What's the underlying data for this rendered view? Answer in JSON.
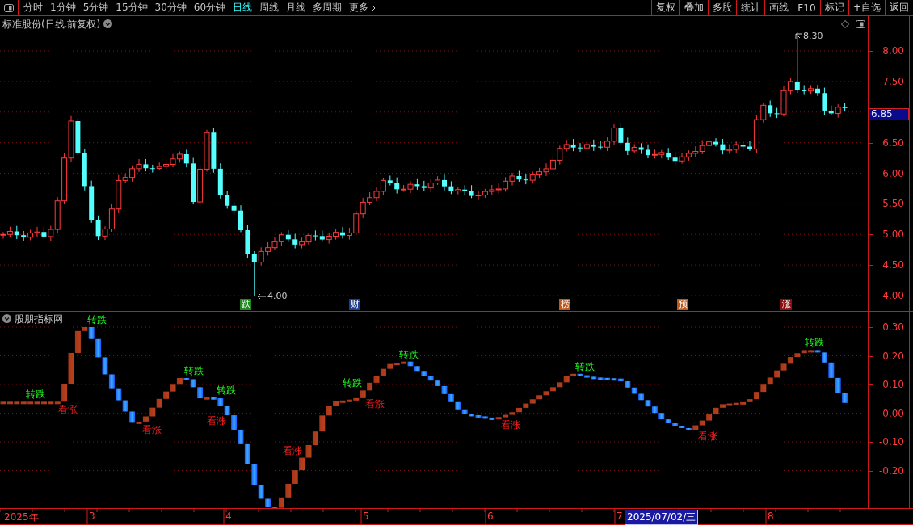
{
  "toolbar": {
    "periods": [
      {
        "label": "分时",
        "selected": false
      },
      {
        "label": "1分钟",
        "selected": false
      },
      {
        "label": "5分钟",
        "selected": false
      },
      {
        "label": "15分钟",
        "selected": false
      },
      {
        "label": "30分钟",
        "selected": false
      },
      {
        "label": "60分钟",
        "selected": false
      },
      {
        "label": "日线",
        "selected": true
      },
      {
        "label": "周线",
        "selected": false
      },
      {
        "label": "月线",
        "selected": false
      },
      {
        "label": "多周期",
        "selected": false
      }
    ],
    "more": "更多",
    "actions": [
      "复权",
      "叠加",
      "多股",
      "统计",
      "画线",
      "F10",
      "标记",
      "+自选",
      "返回"
    ]
  },
  "main_chart": {
    "title": "标准股份(日线.前复权)",
    "price_axis": [
      "8.00",
      "7.50",
      "6.50",
      "6.00",
      "5.50",
      "5.00",
      "4.50",
      "4.00"
    ],
    "current_price": "6.85",
    "high_label": "8.30",
    "low_label": "4.00",
    "events": [
      {
        "text": "跌",
        "color": "#1d8a1d"
      },
      {
        "text": "财",
        "color": "#1c3f94"
      },
      {
        "text": "榜",
        "color": "#c0581a"
      },
      {
        "text": "预",
        "color": "#c0581a"
      },
      {
        "text": "涨",
        "color": "#8a1010"
      }
    ]
  },
  "indicator": {
    "title": "股朋指标网",
    "axis": [
      "0.30",
      "0.20",
      "0.10",
      "-0.00",
      "-0.10",
      "-0.20"
    ],
    "signals": [
      {
        "text": "转跌",
        "kind": "bearish"
      },
      {
        "text": "看涨",
        "kind": "bullish"
      },
      {
        "text": "转跌",
        "kind": "bearish"
      },
      {
        "text": "看涨",
        "kind": "bullish"
      },
      {
        "text": "转跌",
        "kind": "bearish"
      },
      {
        "text": "看涨",
        "kind": "bullish"
      },
      {
        "text": "转跌",
        "kind": "bearish"
      },
      {
        "text": "看涨",
        "kind": "bullish"
      },
      {
        "text": "转跌",
        "kind": "bearish"
      },
      {
        "text": "看涨",
        "kind": "bullish"
      },
      {
        "text": "转跌",
        "kind": "bearish"
      },
      {
        "text": "看涨",
        "kind": "bullish"
      },
      {
        "text": "转跌",
        "kind": "bearish"
      },
      {
        "text": "看涨",
        "kind": "bullish"
      },
      {
        "text": "转跌",
        "kind": "bearish"
      }
    ]
  },
  "date_axis": {
    "labels": [
      "2025年",
      "3",
      "4",
      "5",
      "6",
      "7",
      "8"
    ],
    "cursor_date": "2025/07/02/三"
  }
}
